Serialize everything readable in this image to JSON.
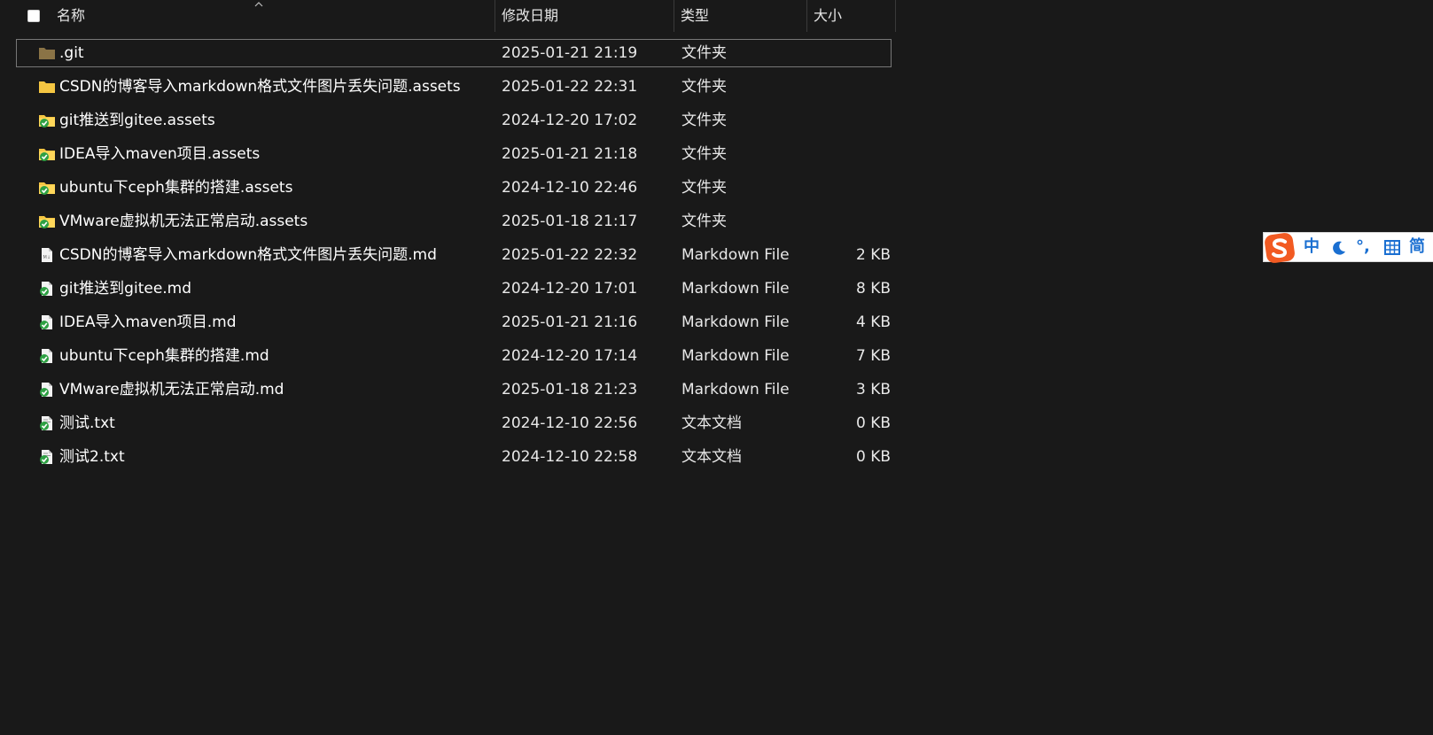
{
  "columns": {
    "name": "名称",
    "date": "修改日期",
    "type": "类型",
    "size": "大小"
  },
  "files": [
    {
      "name": ".git",
      "date": "2025-01-21 21:19",
      "type": "文件夹",
      "size": "",
      "icon": "folder-icon"
    },
    {
      "name": "CSDN的博客导入markdown格式文件图片丢失问题.assets",
      "date": "2025-01-22 22:31",
      "type": "文件夹",
      "size": "",
      "icon": "folder-icon"
    },
    {
      "name": "git推送到gitee.assets",
      "date": "2024-12-20 17:02",
      "type": "文件夹",
      "size": "",
      "icon": "folder-synced-icon"
    },
    {
      "name": "IDEA导入maven项目.assets",
      "date": "2025-01-21 21:18",
      "type": "文件夹",
      "size": "",
      "icon": "folder-synced-icon"
    },
    {
      "name": "ubuntu下ceph集群的搭建.assets",
      "date": "2024-12-10 22:46",
      "type": "文件夹",
      "size": "",
      "icon": "folder-synced-icon"
    },
    {
      "name": "VMware虚拟机无法正常启动.assets",
      "date": "2025-01-18 21:17",
      "type": "文件夹",
      "size": "",
      "icon": "folder-synced-icon"
    },
    {
      "name": "CSDN的博客导入markdown格式文件图片丢失问题.md",
      "date": "2025-01-22 22:32",
      "type": "Markdown File",
      "size": "2 KB",
      "icon": "markdown-file-icon"
    },
    {
      "name": "git推送到gitee.md",
      "date": "2024-12-20 17:01",
      "type": "Markdown File",
      "size": "8 KB",
      "icon": "markdown-file-synced-icon"
    },
    {
      "name": "IDEA导入maven项目.md",
      "date": "2025-01-21 21:16",
      "type": "Markdown File",
      "size": "4 KB",
      "icon": "markdown-file-synced-icon"
    },
    {
      "name": "ubuntu下ceph集群的搭建.md",
      "date": "2024-12-20 17:14",
      "type": "Markdown File",
      "size": "7 KB",
      "icon": "markdown-file-synced-icon"
    },
    {
      "name": "VMware虚拟机无法正常启动.md",
      "date": "2025-01-18 21:23",
      "type": "Markdown File",
      "size": "3 KB",
      "icon": "markdown-file-synced-icon"
    },
    {
      "name": "测试.txt",
      "date": "2024-12-10 22:56",
      "type": "文本文档",
      "size": "0 KB",
      "icon": "text-file-synced-icon"
    },
    {
      "name": "测试2.txt",
      "date": "2024-12-10 22:58",
      "type": "文本文档",
      "size": "0 KB",
      "icon": "text-file-synced-icon"
    }
  ],
  "ime": {
    "mode": "中",
    "punct": "°,",
    "script": "简",
    "logo_color": "#f25a22",
    "accent_color": "#1a6fd1"
  },
  "colors": {
    "background": "#191919",
    "folder": "#f4c542",
    "git_folder": "#8a7346",
    "sync_check": "#2ea043"
  }
}
